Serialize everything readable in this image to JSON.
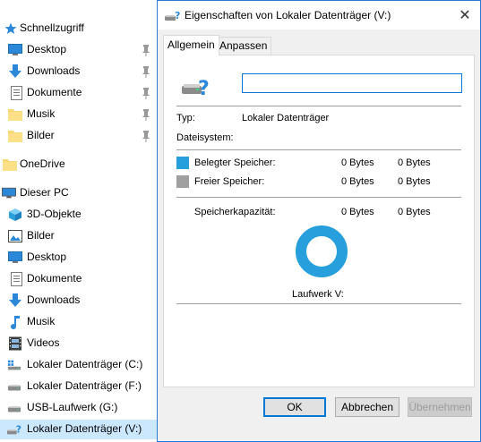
{
  "nav": {
    "quick_access": "Schnellzugriff",
    "quick_items": [
      {
        "label": "Desktop",
        "icon": "desktop-icon"
      },
      {
        "label": "Downloads",
        "icon": "downloads-icon"
      },
      {
        "label": "Dokumente",
        "icon": "documents-icon"
      },
      {
        "label": "Musik",
        "icon": "folder-icon"
      },
      {
        "label": "Bilder",
        "icon": "folder-icon"
      }
    ],
    "onedrive": "OneDrive",
    "this_pc": "Dieser PC",
    "pc_items": [
      {
        "label": "3D-Objekte",
        "icon": "3d-objects-icon"
      },
      {
        "label": "Bilder",
        "icon": "pictures-icon"
      },
      {
        "label": "Desktop",
        "icon": "desktop-icon"
      },
      {
        "label": "Dokumente",
        "icon": "documents-icon"
      },
      {
        "label": "Downloads",
        "icon": "downloads-icon"
      },
      {
        "label": "Musik",
        "icon": "music-icon"
      },
      {
        "label": "Videos",
        "icon": "videos-icon"
      },
      {
        "label": "Lokaler Datenträger (C:)",
        "icon": "system-drive-icon"
      },
      {
        "label": "Lokaler Datenträger (F:)",
        "icon": "drive-icon"
      },
      {
        "label": "USB-Laufwerk (G:)",
        "icon": "drive-icon"
      },
      {
        "label": "Lokaler Datenträger (V:)",
        "icon": "unknown-drive-icon",
        "selected": true
      }
    ]
  },
  "dialog": {
    "title": "Eigenschaften von Lokaler Datenträger (V:)",
    "close_glyph": "✕",
    "tabs": [
      {
        "label": "Allgemein",
        "active": true
      },
      {
        "label": "Anpassen",
        "active": false
      }
    ],
    "name_value": "",
    "type_label": "Typ:",
    "type_value": "Lokaler Datenträger",
    "fs_label": "Dateisystem:",
    "fs_value": "",
    "used_label": "Belegter Speicher:",
    "used_bytes": "0 Bytes",
    "used_size": "0 Bytes",
    "free_label": "Freier Speicher:",
    "free_bytes": "0 Bytes",
    "free_size": "0 Bytes",
    "capacity_label": "Speicherkapazität:",
    "capacity_bytes": "0 Bytes",
    "capacity_size": "0 Bytes",
    "drive_label": "Laufwerk V:",
    "buttons": {
      "ok": "OK",
      "cancel": "Abbrechen",
      "apply": "Übernehmen"
    },
    "colors": {
      "used": "#269fdc",
      "free": "#a0a0a0",
      "accent": "#0078d7"
    }
  }
}
